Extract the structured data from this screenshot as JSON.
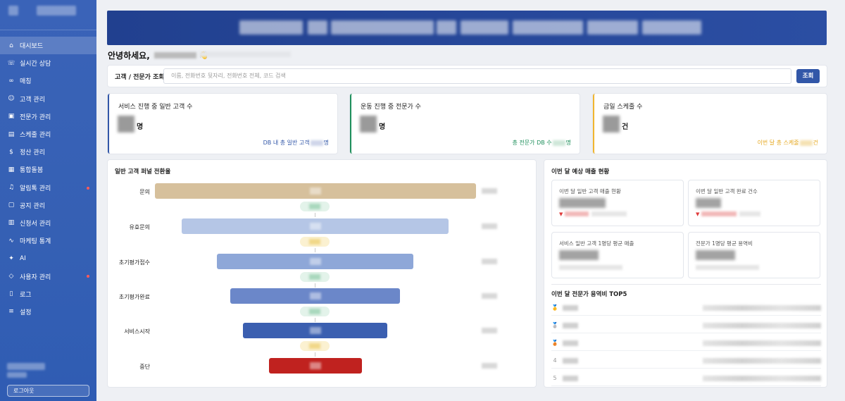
{
  "sidebar": {
    "items": [
      {
        "label": "대시보드",
        "icon": "home-icon",
        "glyph": "⌂",
        "active": true
      },
      {
        "label": "실시간 상담",
        "icon": "phone-icon",
        "glyph": "☏"
      },
      {
        "label": "매칭",
        "icon": "link-icon",
        "glyph": "∞"
      },
      {
        "label": "고객 관리",
        "icon": "users-icon",
        "glyph": "☺"
      },
      {
        "label": "전문가 관리",
        "icon": "briefcase-icon",
        "glyph": "▣"
      },
      {
        "label": "스케줄 관리",
        "icon": "calendar-icon",
        "glyph": "▤"
      },
      {
        "label": "정산 관리",
        "icon": "dollar-icon",
        "glyph": "$"
      },
      {
        "label": "통합돌봄",
        "icon": "document-icon",
        "glyph": "▦"
      },
      {
        "label": "알림톡 관리",
        "icon": "bell-icon",
        "glyph": "♫",
        "badge": true
      },
      {
        "label": "공지 관리",
        "icon": "clipboard-icon",
        "glyph": "▢"
      },
      {
        "label": "신청서 관리",
        "icon": "form-icon",
        "glyph": "▥"
      },
      {
        "label": "마케팅 통계",
        "icon": "activity-icon",
        "glyph": "∿"
      },
      {
        "label": "AI",
        "icon": "sparkle-icon",
        "glyph": "✦"
      },
      {
        "label": "사용자 관리",
        "icon": "shield-icon",
        "glyph": "◇",
        "badge": true
      },
      {
        "label": "로그",
        "icon": "file-icon",
        "glyph": "▯"
      },
      {
        "label": "설정",
        "icon": "sliders-icon",
        "glyph": "≡"
      }
    ],
    "logout": "로그아웃"
  },
  "greeting": {
    "text": "안녕하세요,",
    "hand": "👋"
  },
  "search": {
    "label": "고객 / 전문가 조회",
    "placeholder": "이름, 전화번호 뒷자리, 전화번호 전체, 코드 검색",
    "button": "조회"
  },
  "stats": [
    {
      "title": "서비스 진행 중 일반 고객 수",
      "unit": "명",
      "foot_prefix": "DB 내 총 일반 고객",
      "foot_suffix": "명",
      "color": "#3257a8"
    },
    {
      "title": "운동 진행 중 전문가 수",
      "unit": "명",
      "foot_prefix": "총 전문가 DB 수",
      "foot_suffix": "명",
      "color": "#1e8f5b"
    },
    {
      "title": "금일 스케줄 수",
      "unit": "건",
      "foot_prefix": "이번 달 총 스케줄",
      "foot_suffix": "건",
      "color": "#f1b62f"
    }
  ],
  "funnel": {
    "title": "일반 고객 퍼널 전환율",
    "stages": [
      {
        "label": "문의",
        "color": "#d6c09c"
      },
      {
        "label": "유효문의",
        "color": "#b5c6e6"
      },
      {
        "label": "초기평가접수",
        "color": "#8ea7d8"
      },
      {
        "label": "초기평가완료",
        "color": "#6b87c9"
      },
      {
        "label": "서비스시작",
        "color": "#3b5fb0"
      },
      {
        "label": "중단",
        "color": "#c0221f"
      }
    ]
  },
  "revenue": {
    "title": "이번 달 예상 매출 현황",
    "cards": [
      {
        "title": "이번 달 일반 고객 매출 현황",
        "trend": "down"
      },
      {
        "title": "이번 달 일반 고객 완료 건수",
        "trend": "down"
      },
      {
        "title": "서비스 일반 고객 1명당 평균 매출"
      },
      {
        "title": "전문가 1명당 평균 용역비"
      }
    ],
    "down_glyph": "▼"
  },
  "top5": {
    "title": "이번 달 전문가 용역비 TOP5",
    "ranks": [
      "🥇",
      "🥈",
      "🥉",
      "4",
      "5"
    ]
  }
}
